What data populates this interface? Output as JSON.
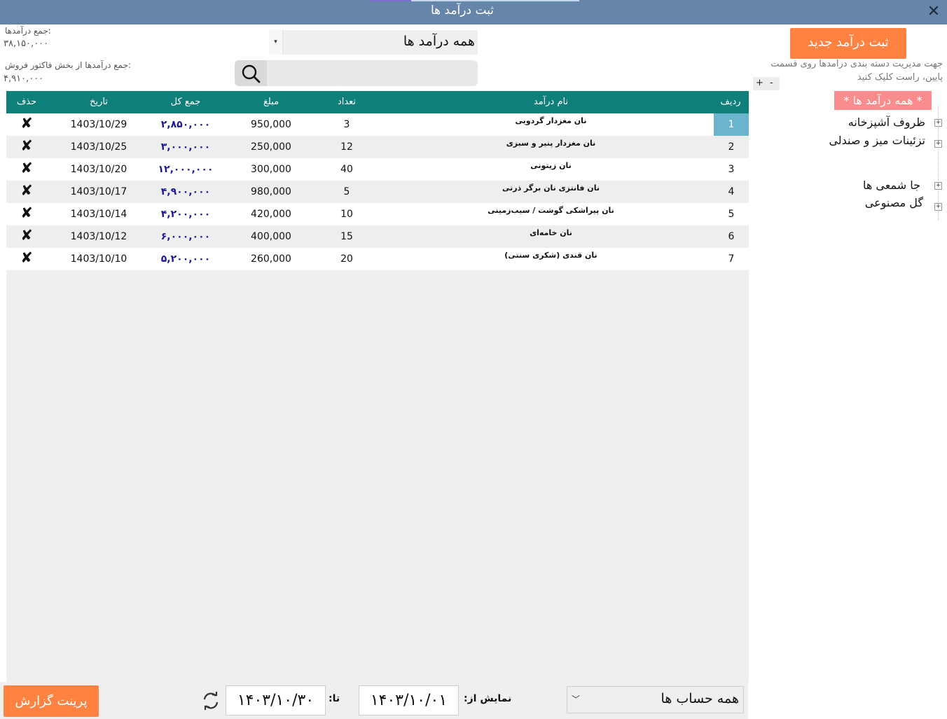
{
  "window": {
    "title": "ثبت درآمد ها",
    "close_icon": "close-icon"
  },
  "summary": {
    "total_label": "جمع درآمدها:",
    "total_value": "۳۸,۱۵۰,۰۰۰",
    "invoice_label": "جمع درآمدها از بخش فاکتور فروش:",
    "invoice_value": "۴,۹۱۰,۰۰۰"
  },
  "category_filter": {
    "selected": "همه درآمد ها"
  },
  "search": {
    "placeholder": "",
    "value": "",
    "icon": "search-icon"
  },
  "table": {
    "columns": [
      "حذف",
      "تاریخ",
      "جمع کل",
      "مبلغ",
      "تعداد",
      "نام درآمد",
      "ردیف"
    ],
    "rows": [
      {
        "delete": "✘",
        "date": "1403/10/29",
        "total": "۲,۸۵۰,۰۰۰",
        "amount": "950,000",
        "count": "3",
        "name": "نان مغزدار گردویی",
        "index": "1"
      },
      {
        "delete": "✘",
        "date": "1403/10/25",
        "total": "۳,۰۰۰,۰۰۰",
        "amount": "250,000",
        "count": "12",
        "name": "نان مغزدار پنیر و سبزی",
        "index": "2"
      },
      {
        "delete": "✘",
        "date": "1403/10/20",
        "total": "۱۲,۰۰۰,۰۰۰",
        "amount": "300,000",
        "count": "40",
        "name": "نان زیتونی",
        "index": "3"
      },
      {
        "delete": "✘",
        "date": "1403/10/17",
        "total": "۴,۹۰۰,۰۰۰",
        "amount": "980,000",
        "count": "5",
        "name": "نان فانتزی نان برگر ذرتی",
        "index": "4"
      },
      {
        "delete": "✘",
        "date": "1403/10/14",
        "total": "۴,۲۰۰,۰۰۰",
        "amount": "420,000",
        "count": "10",
        "name": "نان پیراشکی گوشت / سیب‌زمینی",
        "index": "5"
      },
      {
        "delete": "✘",
        "date": "1403/10/12",
        "total": "۶,۰۰۰,۰۰۰",
        "amount": "400,000",
        "count": "15",
        "name": "نان خامه‌ای",
        "index": "6"
      },
      {
        "delete": "✘",
        "date": "1403/10/10",
        "total": "۵,۲۰۰,۰۰۰",
        "amount": "260,000",
        "count": "20",
        "name": "نان قندی (شکری سنتی)",
        "index": "7"
      }
    ],
    "selected_row": 0
  },
  "sidebar": {
    "new_button": "ثبت درآمد جدید",
    "hint": "جهت مدیریت دسته بندی درامدها روی قسمت پایین، راست کلیک کنید",
    "expand_all": "+",
    "collapse_all": "-",
    "root": "* همه درآمد ها *",
    "categories": [
      {
        "label": "ظروف آشپزخانه"
      },
      {
        "label": "تزئینات میز و صندلی"
      },
      {
        "label": "جا شمعی ها"
      },
      {
        "label": "گل مصنوعی"
      }
    ]
  },
  "footer": {
    "print_button": "پرینت گزارش",
    "to_label": "تا:",
    "to_date": "۱۴۰۳/۱۰/۳۰",
    "from_label": "نمایش از:",
    "from_date": "۱۴۰۳/۱۰/۰۱",
    "account_select": "همه حساب ها",
    "refresh_icon": "refresh-icon"
  },
  "colors": {
    "titlebar": "#6586a8",
    "table_header": "#0f7f7a",
    "accent_button": "#ff8241",
    "tree_root": "#f98c8c",
    "selected_row": "#6bb5cc",
    "total_text": "#1a1a9a"
  }
}
